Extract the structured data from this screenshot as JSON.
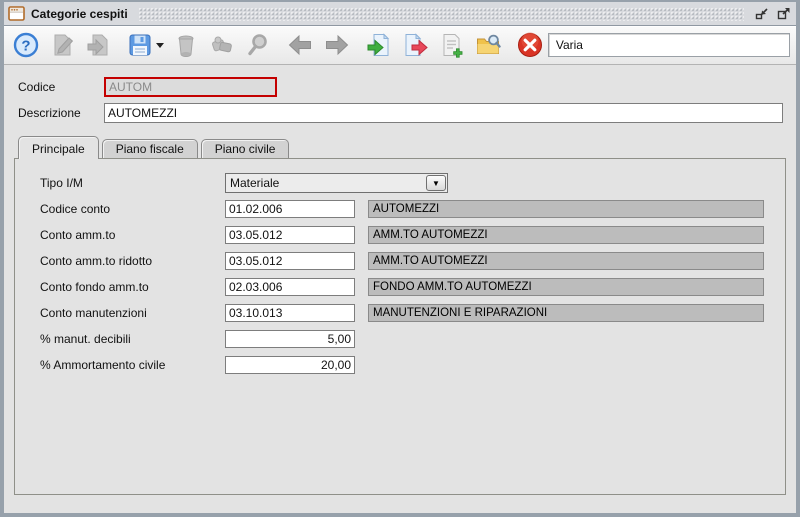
{
  "window": {
    "title": "Categorie cespiti"
  },
  "toolbar": {
    "context_value": "Varia",
    "icons": [
      {
        "name": "help",
        "enabled": true
      },
      {
        "name": "edit",
        "enabled": false
      },
      {
        "name": "new",
        "enabled": false
      },
      {
        "name": "save",
        "enabled": true,
        "has_dropdown": true
      },
      {
        "name": "delete",
        "enabled": false
      },
      {
        "name": "duplicate",
        "enabled": false
      },
      {
        "name": "search",
        "enabled": false
      },
      {
        "name": "previous",
        "enabled": true
      },
      {
        "name": "next",
        "enabled": true
      },
      {
        "name": "import",
        "enabled": true
      },
      {
        "name": "export",
        "enabled": true
      },
      {
        "name": "new-document",
        "enabled": true
      },
      {
        "name": "archive-search",
        "enabled": true
      },
      {
        "name": "close",
        "enabled": true
      }
    ]
  },
  "icons": {
    "help_glyph": "?",
    "dropdown_glyph": "▼"
  },
  "header": {
    "codice": {
      "label": "Codice",
      "value": "AUTOM"
    },
    "descrizione": {
      "label": "Descrizione",
      "value": "AUTOMEZZI"
    }
  },
  "tabs": [
    {
      "label": "Principale",
      "selected": true
    },
    {
      "label": "Piano fiscale",
      "selected": false
    },
    {
      "label": "Piano civile",
      "selected": false
    }
  ],
  "form": {
    "rows": [
      {
        "label": "Tipo I/M",
        "type": "combobox",
        "value": "Materiale"
      },
      {
        "label": "Codice conto",
        "type": "text",
        "value": "01.02.006",
        "description": "AUTOMEZZI"
      },
      {
        "label": "Conto amm.to",
        "type": "text",
        "value": "03.05.012",
        "description": "AMM.TO AUTOMEZZI"
      },
      {
        "label": "Conto amm.to ridotto",
        "type": "text",
        "value": "03.05.012",
        "description": "AMM.TO AUTOMEZZI"
      },
      {
        "label": "Conto fondo amm.to",
        "type": "text",
        "value": "02.03.006",
        "description": "FONDO AMM.TO AUTOMEZZI"
      },
      {
        "label": "Conto manutenzioni",
        "type": "text",
        "value": "03.10.013",
        "description": "MANUTENZIONI E RIPARAZIONI"
      },
      {
        "label": "% manut. decibili",
        "type": "number",
        "value": "5,00"
      },
      {
        "label": "% Ammortamento civile",
        "type": "number",
        "value": "20,00"
      }
    ]
  },
  "colors": {
    "window_border": "#97a1ab",
    "titlebar_bg": "#d8dade",
    "content_bg": "#e3e3e3",
    "error_field_border": "#c40000",
    "readonly_field_bg": "#bcbcbc",
    "disabled_text": "#8a8a8a",
    "help_blue": "#3b7fd4",
    "close_red": "#d93425",
    "folder_yellow": "#f0c24a"
  }
}
